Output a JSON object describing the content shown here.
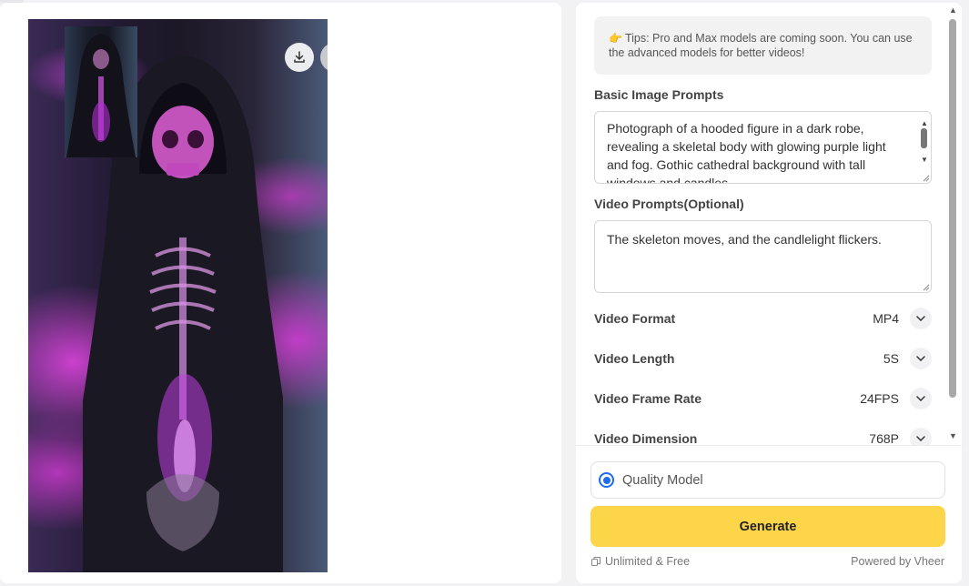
{
  "preview": {
    "download_icon": "download-icon",
    "delete_icon": "trash-icon"
  },
  "tips": {
    "icon": "pointing-hand-icon",
    "text": "Tips: Pro and Max models are coming soon. You can use the advanced models for better videos!"
  },
  "basic_prompt": {
    "label": "Basic Image Prompts",
    "value": "Photograph of a hooded figure in a dark robe, revealing a skeletal body with glowing purple light and fog. Gothic cathedral background with tall windows and candles."
  },
  "video_prompt": {
    "label": "Video Prompts(Optional)",
    "value": "The skeleton moves, and the candlelight flickers."
  },
  "settings": [
    {
      "name": "Video Format",
      "value": "MP4"
    },
    {
      "name": "Video Length",
      "value": "5S"
    },
    {
      "name": "Video Frame Rate",
      "value": "24FPS"
    },
    {
      "name": "Video Dimension",
      "value": "768P"
    }
  ],
  "model": {
    "label": "Quality Model",
    "selected": true
  },
  "generate_label": "Generate",
  "footer": {
    "left": "Unlimited & Free",
    "right": "Powered by Vheer"
  },
  "colors": {
    "accent_yellow": "#fdd548",
    "radio_blue": "#1e6af0"
  }
}
